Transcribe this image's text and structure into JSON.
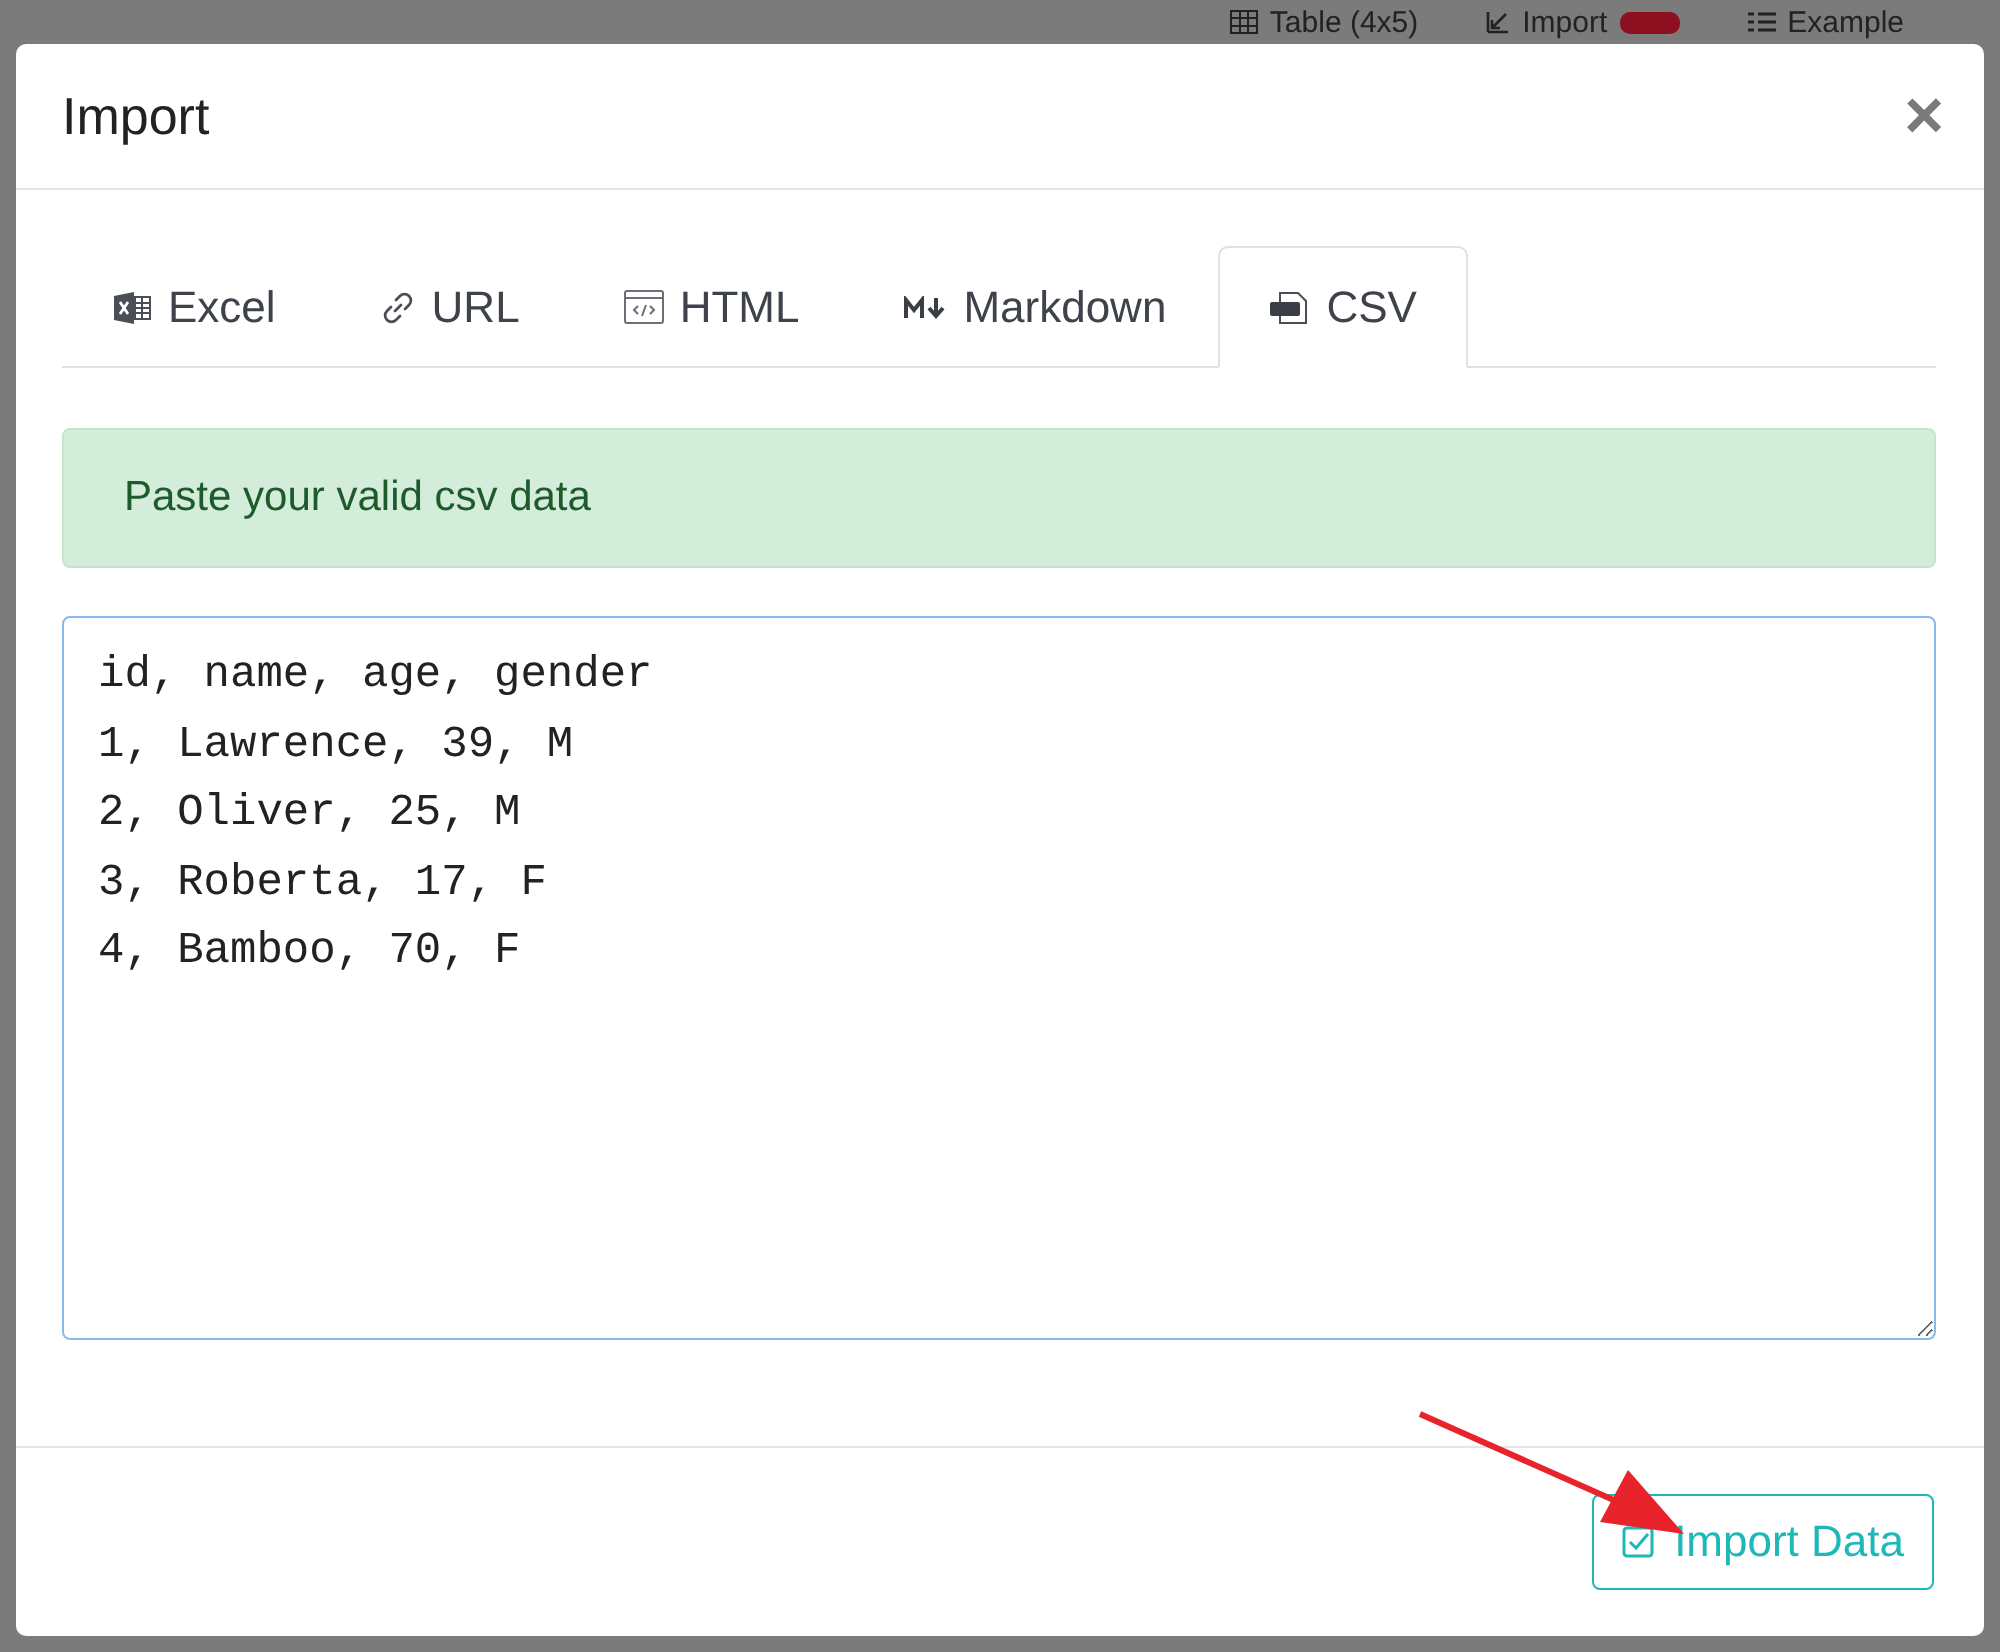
{
  "background_toolbar": {
    "items": [
      "Table (4x5)",
      "Import",
      "Example"
    ]
  },
  "dialog": {
    "title": "Import",
    "close": "×",
    "tabs": [
      {
        "label": "Excel",
        "selected": false
      },
      {
        "label": "URL",
        "selected": false
      },
      {
        "label": "HTML",
        "selected": false
      },
      {
        "label": "Markdown",
        "selected": false
      },
      {
        "label": "CSV",
        "selected": true
      }
    ],
    "alert": "Paste your valid csv data",
    "csv_input": {
      "value": "id, name, age, gender\n1, Lawrence, 39, M\n2, Oliver, 25, M\n3, Roberta, 17, F\n4, Bamboo, 70, F"
    },
    "button": "Import Data"
  }
}
